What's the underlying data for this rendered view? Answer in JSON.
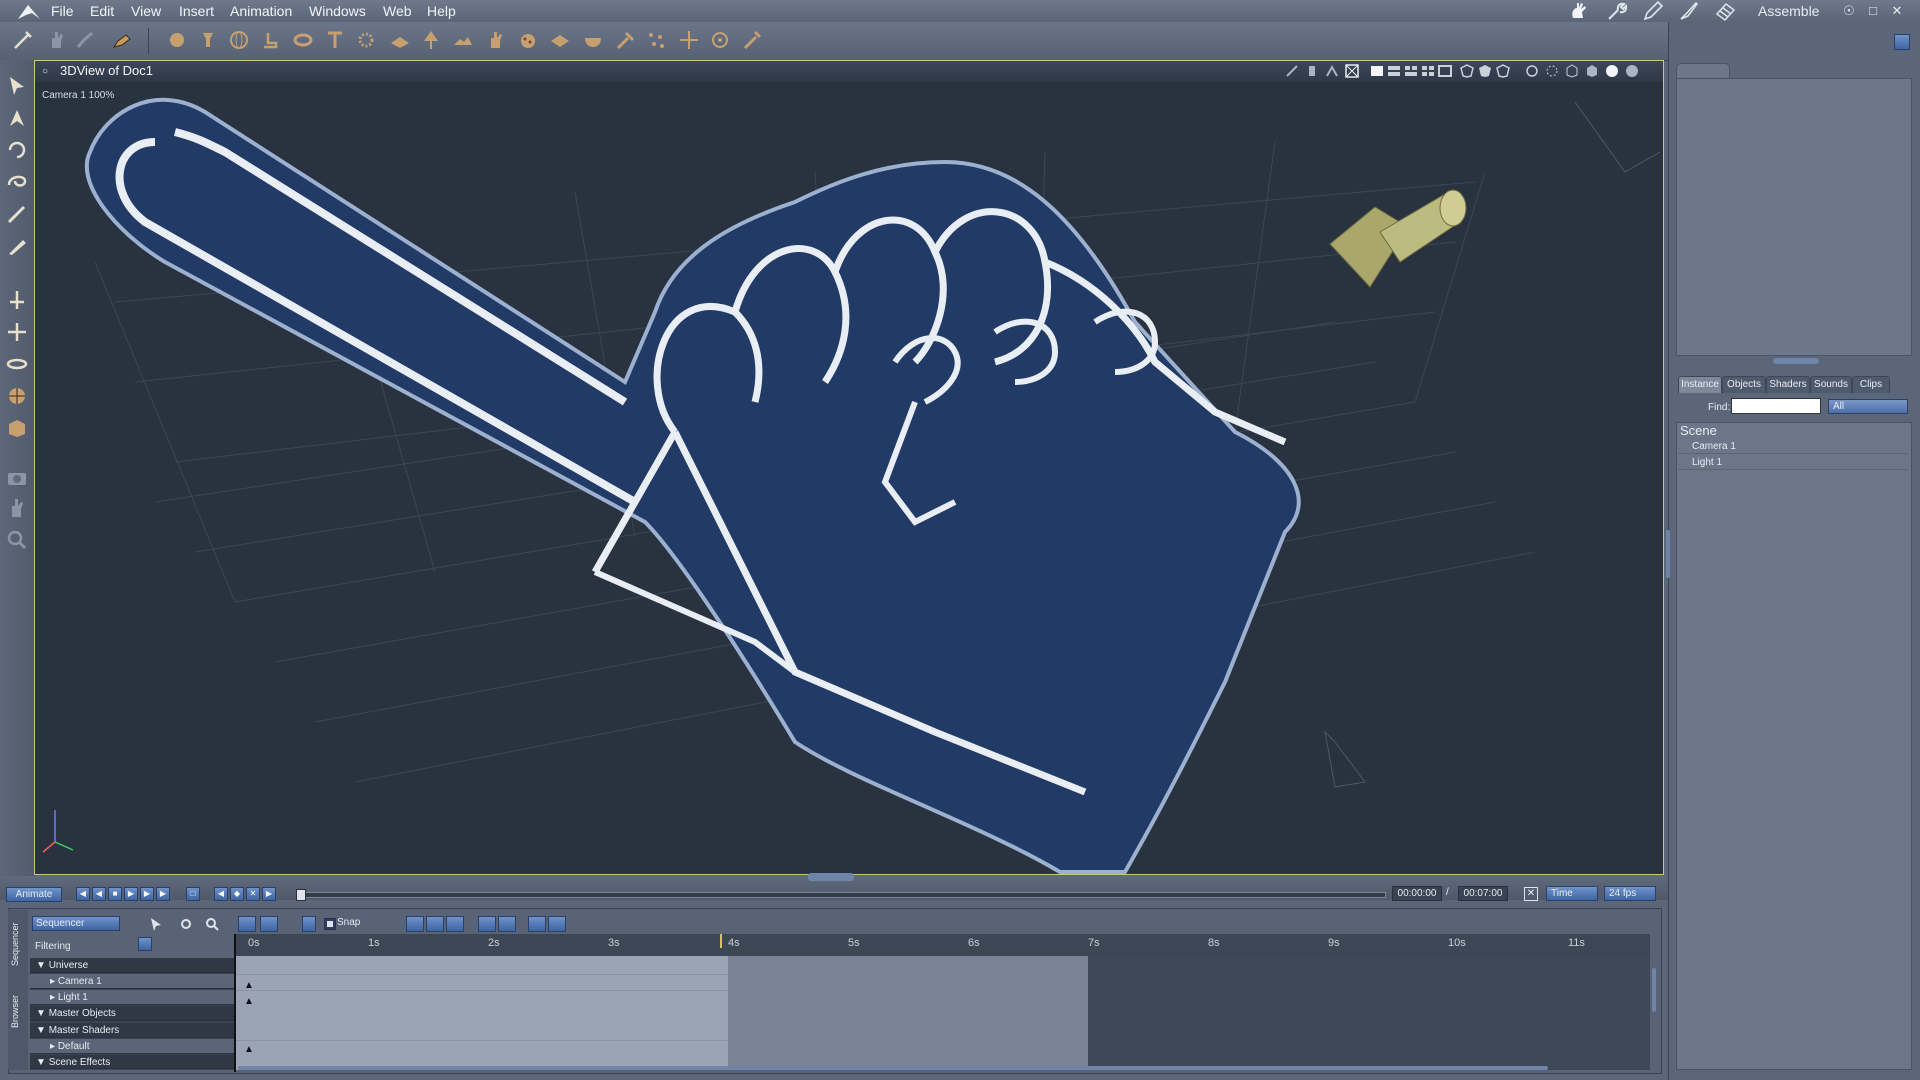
{
  "menubar": {
    "items": [
      "File",
      "Edit",
      "View",
      "Insert",
      "Animation",
      "Windows",
      "Web",
      "Help"
    ],
    "room": "Assemble"
  },
  "viewport": {
    "title": "3DView of Doc1",
    "camera_label": "Camera 1 100%"
  },
  "right_panel": {
    "tabs": [
      "Instance",
      "Objects",
      "Shaders",
      "Sounds",
      "Clips"
    ],
    "active_tab": "Instance",
    "find_label": "Find:",
    "find_value": "",
    "filter_value": "All",
    "scene_header": "Scene",
    "scene_items": [
      "Camera 1",
      "Light 1"
    ]
  },
  "animation": {
    "animate_label": "Animate",
    "current_time": "00:00:00",
    "end_time": "00:07:00",
    "time_mode": "Time",
    "fps": "24 fps",
    "playhead_progress": 0.0
  },
  "sequencer": {
    "mode": "Sequencer",
    "side_tabs": [
      "Sequencer",
      "Browser"
    ],
    "filtering_label": "Filtering",
    "snap_label": "Snap",
    "snap_checked": true,
    "ruler_labels": [
      "0s",
      "1s",
      "2s",
      "3s",
      "4s",
      "5s",
      "6s",
      "7s",
      "8s",
      "9s",
      "10s",
      "11s"
    ],
    "tree": [
      {
        "label": "Universe",
        "level": 0
      },
      {
        "label": "Camera 1",
        "level": 1
      },
      {
        "label": "Light 1",
        "level": 1
      },
      {
        "label": "Master Objects",
        "level": 0
      },
      {
        "label": "Master Shaders",
        "level": 0
      },
      {
        "label": "Default",
        "level": 1
      },
      {
        "label": "Scene Effects",
        "level": 0
      }
    ]
  },
  "colors": {
    "foam_hand": "#223a66",
    "foam_outline": "#e9edf4",
    "selection_frame": "#c9c48a",
    "light_arrow": "#a9a86a",
    "accent_blue": "#4e6fa8"
  },
  "icons": {
    "toolbar": [
      "sphere-icon",
      "cylinder-icon",
      "globe-icon",
      "figure-icon",
      "torus-icon",
      "text-icon",
      "gear-icon",
      "plane-icon",
      "tree-icon",
      "terrain-icon",
      "hand-icon",
      "bumpy-icon",
      "grid-icon",
      "bowl-icon",
      "hammer-icon",
      "scatter-icon",
      "move-icon",
      "target-icon",
      "wrench-icon"
    ],
    "left_tools": [
      "select-icon",
      "direct-select-icon",
      "rotate-icon",
      "twist-icon",
      "brush-icon",
      "knife-icon",
      "move-axis-icon",
      "translate-icon",
      "scale-icon",
      "orbit-icon",
      "box-icon",
      "camera-icon",
      "pan-hand-icon",
      "zoom-icon"
    ]
  }
}
